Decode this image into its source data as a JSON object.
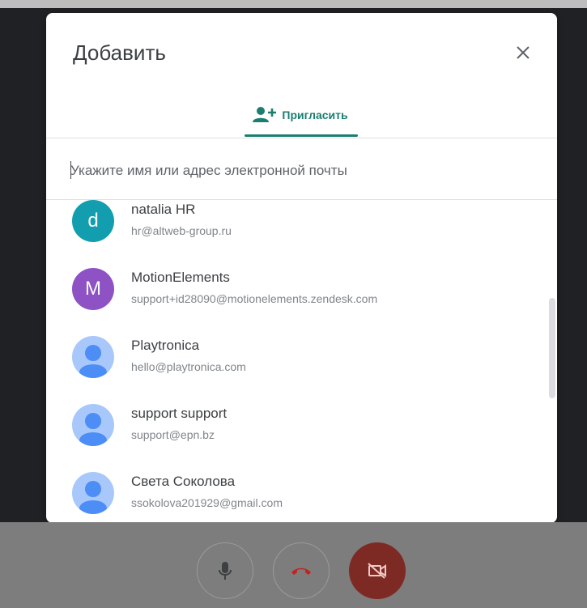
{
  "dialog": {
    "title": "Добавить",
    "tab_label": "Пригласить",
    "search_placeholder": "Укажите имя или адрес электронной почты"
  },
  "contacts": [
    {
      "name": "natalia HR",
      "email": "hr@altweb-group.ru",
      "avatar_type": "letter",
      "letter": "d",
      "color": "#129eaf"
    },
    {
      "name": "MotionElements",
      "email": "support+id28090@motionelements.zendesk.com",
      "avatar_type": "letter",
      "letter": "M",
      "color": "#8e52c5"
    },
    {
      "name": "Playtronica",
      "email": "hello@playtronica.com",
      "avatar_type": "person-icon",
      "color": "#a8c7fa"
    },
    {
      "name": "support support",
      "email": "support@epn.bz",
      "avatar_type": "person-icon",
      "color": "#a8c7fa"
    },
    {
      "name": "Света Соколова",
      "email": "ssokolova201929@gmail.com",
      "avatar_type": "person-icon",
      "color": "#a8c7fa"
    }
  ],
  "controls": {
    "mic": "microphone-icon",
    "hangup": "hang-up-icon",
    "camera": "camera-off-icon",
    "hangup_color": "#c5221f",
    "camera_bg": "#7e2a24"
  },
  "colors": {
    "accent": "#1a7f70",
    "avatar_person_fg": "#4c8df6"
  }
}
